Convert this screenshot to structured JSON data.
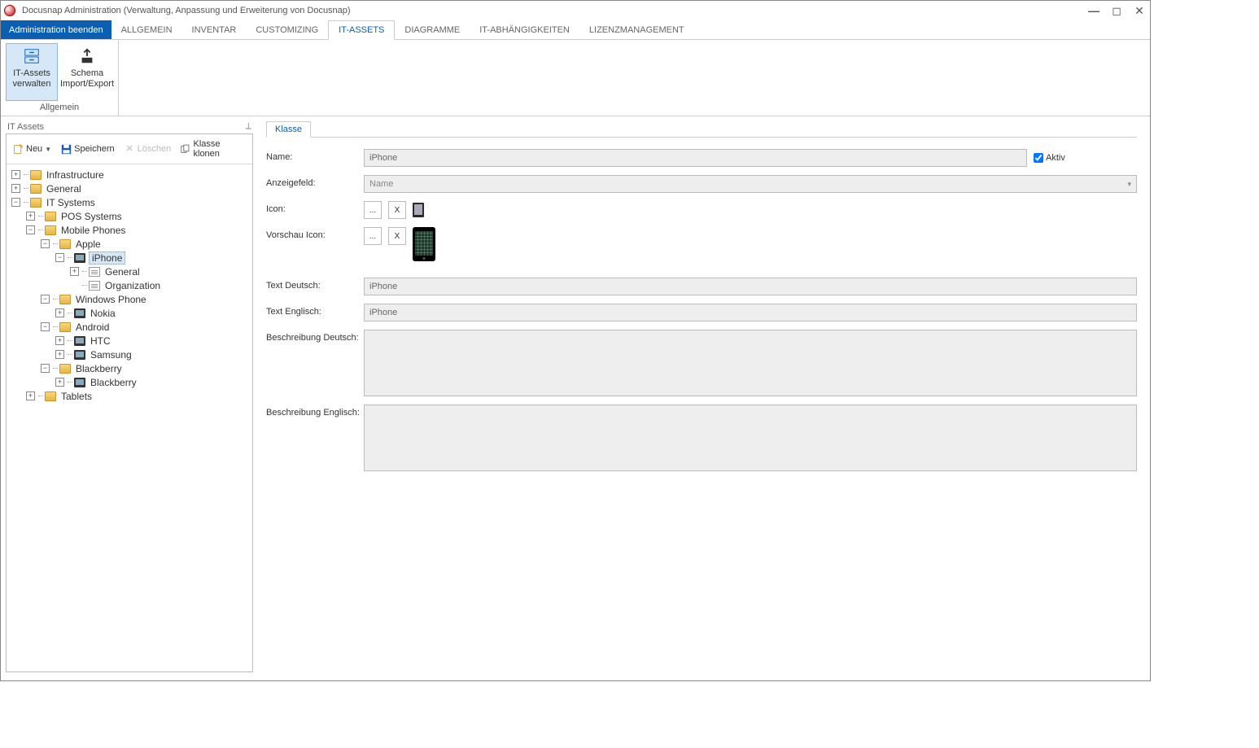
{
  "window": {
    "title": "Docusnap Administration (Verwaltung, Anpassung und Erweiterung von Docusnap)"
  },
  "menu": {
    "endadmin": "Administration beenden",
    "tabs": [
      "ALLGEMEIN",
      "INVENTAR",
      "CUSTOMIZING",
      "IT-ASSETS",
      "DIAGRAMME",
      "IT-ABHÄNGIGKEITEN",
      "LIZENZMANAGEMENT"
    ],
    "active_tab_index": 3
  },
  "ribbon": {
    "group_label": "Allgemein",
    "btn1_line1": "IT-Assets",
    "btn1_line2": "verwalten",
    "btn2_line1": "Schema",
    "btn2_line2": "Import/Export"
  },
  "left": {
    "title": "IT Assets",
    "toolbar": {
      "neu": "Neu",
      "speichern": "Speichern",
      "loeschen": "Löschen",
      "klonen": "Klasse klonen"
    }
  },
  "tree": {
    "infrastructure": "Infrastructure",
    "general": "General",
    "it_systems": "IT Systems",
    "pos": "POS Systems",
    "mobile": "Mobile Phones",
    "apple": "Apple",
    "iphone": "iPhone",
    "iphone_general": "General",
    "iphone_org": "Organization",
    "windows_phone": "Windows Phone",
    "nokia": "Nokia",
    "android": "Android",
    "htc": "HTC",
    "samsung": "Samsung",
    "blackberry_folder": "Blackberry",
    "blackberry": "Blackberry",
    "tablets": "Tablets"
  },
  "right": {
    "tab": "Klasse",
    "labels": {
      "name": "Name:",
      "anzeigefeld": "Anzeigefeld:",
      "icon": "Icon:",
      "vorschau_icon": "Vorschau Icon:",
      "text_de": "Text Deutsch:",
      "text_en": "Text Englisch:",
      "beschr_de": "Beschreibung Deutsch:",
      "beschr_en": "Beschreibung Englisch:",
      "aktiv": "Aktiv"
    },
    "values": {
      "name": "iPhone",
      "anzeigefeld": "Name",
      "text_de": "iPhone",
      "text_en": "iPhone",
      "beschr_de": "",
      "beschr_en": ""
    },
    "btn_browse": "...",
    "btn_clear": "X"
  }
}
